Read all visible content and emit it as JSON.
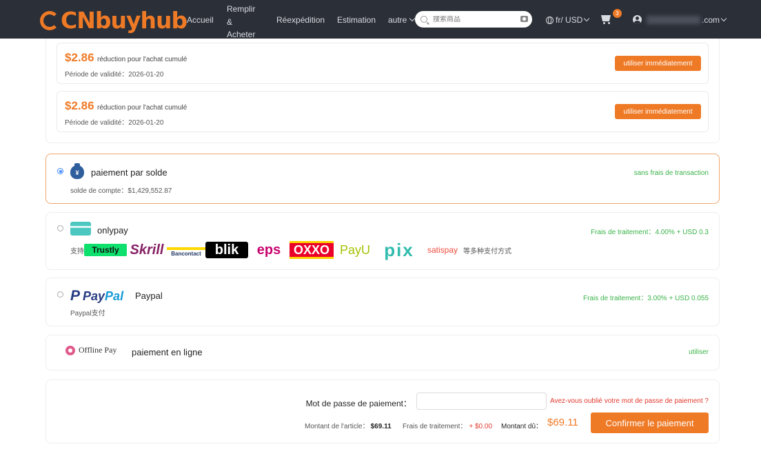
{
  "header": {
    "logo": "CNbuyhub",
    "nav": {
      "accueil": "Accueil",
      "remplir": "Remplir & Acheter",
      "reexpedition": "Réexpédition",
      "estimation": "Estimation",
      "autre": "autre"
    },
    "search_placeholder": "搜索商品",
    "lang_currency": "fr/ USD",
    "cart_count": "3",
    "user_email_suffix": ".com"
  },
  "coupons": [
    {
      "amount": "$2.86",
      "desc": "réduction pour l'achat cumulé",
      "validity": "Période de validité：2026-01-20",
      "button": "utiliser immédiatement"
    },
    {
      "amount": "$2.86",
      "desc": "réduction pour l'achat cumulé",
      "validity": "Période de validité：2026-01-20",
      "button": "utiliser immédiatement"
    }
  ],
  "methods": {
    "balance": {
      "title": "paiement par solde",
      "sub": "solde de compte：$1,429,552.87",
      "fee": "sans frais de transaction",
      "icon_text": "¥",
      "selected": true
    },
    "onlypay": {
      "title": "onlypay",
      "support_prefix": "支持",
      "support_suffix": "等多种支付方式",
      "fee": "Frais de traitement：4.00% + USD 0.3",
      "logos": [
        "Trustly",
        "Skrill",
        "Bancontact",
        "blik",
        "eps",
        "OXXO",
        "PayU",
        "pix",
        "satispay"
      ]
    },
    "paypal": {
      "title": "Paypal",
      "logo_pay": "Pay",
      "logo_pal": "Pal",
      "sub": "Paypal支付",
      "fee": "Frais de traitement：3.00% + USD 0.055"
    },
    "offline": {
      "logo": "Offline Pay",
      "title": "paiement en ligne",
      "action": "utiliser"
    }
  },
  "payment": {
    "password_label": "Mot de passe de paiement：",
    "forgot": "Avez-vous oublié votre mot de passe de paiement ?",
    "item_label": "Montant de l'article：",
    "item_value": "$69.11",
    "fee_label": "Frais de traitement：",
    "fee_value": "+ $0.00",
    "due_label": "Montant dû：",
    "due_value": "$69.11",
    "confirm": "Confirmer le paiement"
  },
  "colors": {
    "header_bg": "#2b2f38",
    "accent": "#ef7a26",
    "fee_green": "#3bb34a",
    "error_red": "#e2392e"
  }
}
